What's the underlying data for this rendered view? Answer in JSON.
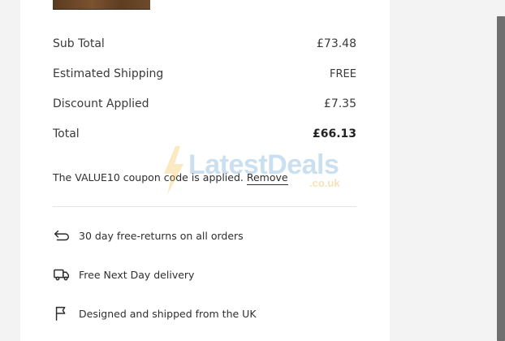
{
  "summary": {
    "sub_total_label": "Sub Total",
    "sub_total_value": "£73.48",
    "shipping_label": "Estimated Shipping",
    "shipping_value": "FREE",
    "discount_label": "Discount Applied",
    "discount_value": "£7.35",
    "total_label": "Total",
    "total_value": "£66.13"
  },
  "coupon": {
    "note_prefix": "The VALUE10 coupon code is applied.",
    "remove_label": "Remove"
  },
  "perks": [
    {
      "icon": "return-arrow-icon",
      "label": "30 day free-returns on all orders"
    },
    {
      "icon": "delivery-truck-icon",
      "label": "Free Next Day delivery"
    },
    {
      "icon": "flag-icon",
      "label": "Designed and shipped from the UK"
    }
  ],
  "watermark": {
    "brand": "LatestDeals",
    "suffix": ".co.uk"
  },
  "colors": {
    "page_bg": "#f3f3f3",
    "card_bg": "#ffffff",
    "text": "#2b2b2b",
    "divider": "#e4e4e4",
    "scrollbar": "#6f6f6f"
  }
}
